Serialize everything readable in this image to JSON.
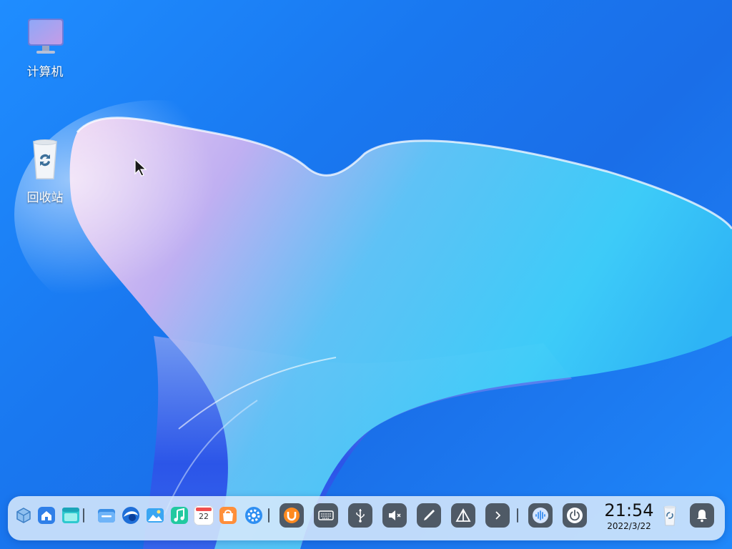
{
  "desktop": {
    "icons": [
      {
        "label": "计算机",
        "icon": "computer-icon"
      },
      {
        "label": "回收站",
        "icon": "trash-icon"
      }
    ]
  },
  "dock": {
    "launchers": [
      {
        "icon": "multitask-view-icon"
      },
      {
        "icon": "home-folder-icon"
      },
      {
        "icon": "window-manager-icon"
      }
    ],
    "apps": [
      {
        "icon": "file-manager-icon"
      },
      {
        "icon": "browser-icon"
      },
      {
        "icon": "image-viewer-icon"
      },
      {
        "icon": "music-player-icon"
      },
      {
        "icon": "calendar-icon",
        "text": "22"
      },
      {
        "icon": "app-store-icon"
      },
      {
        "icon": "settings-icon"
      }
    ],
    "tray": [
      {
        "icon": "input-method-icon"
      },
      {
        "icon": "keyboard-icon"
      },
      {
        "icon": "usb-icon"
      },
      {
        "icon": "volume-muted-icon"
      },
      {
        "icon": "pen-icon"
      },
      {
        "icon": "network-icon"
      },
      {
        "icon": "expand-arrow-icon"
      }
    ],
    "system": [
      {
        "icon": "assistant-icon"
      },
      {
        "icon": "power-icon"
      }
    ],
    "clock": {
      "time": "21:54",
      "date": "2022/3/22"
    },
    "end": [
      {
        "icon": "trash-icon"
      },
      {
        "icon": "notification-bell-icon"
      }
    ]
  },
  "colors": {
    "wallpaper": "#1a78f0",
    "dock_bg": "#d6e8fc",
    "tray_bg": "#4f5a66"
  }
}
